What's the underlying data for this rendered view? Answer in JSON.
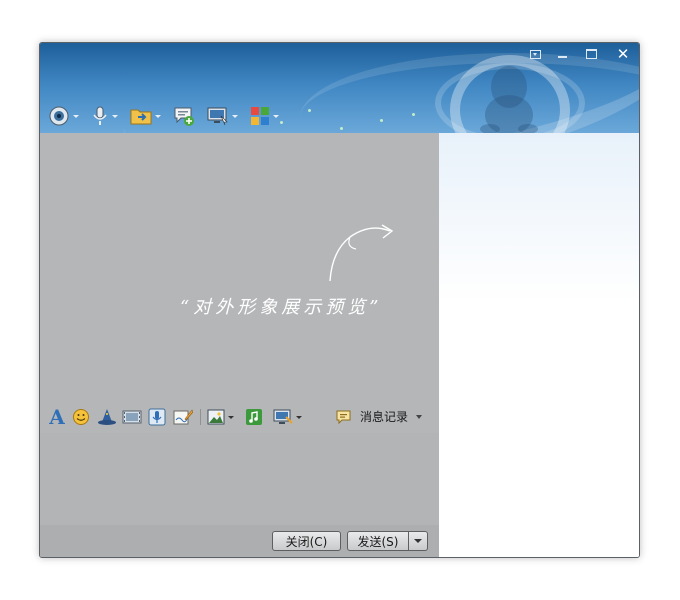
{
  "preview": {
    "text": "“对外形象展示预览”"
  },
  "toolbar": {
    "items": [
      {
        "icon": "video-camera-icon",
        "has_dropdown": true
      },
      {
        "icon": "microphone-icon",
        "has_dropdown": true
      },
      {
        "icon": "file-transfer-icon",
        "has_dropdown": true
      },
      {
        "icon": "group-chat-add-icon",
        "has_dropdown": false
      },
      {
        "icon": "remote-desktop-icon",
        "has_dropdown": true
      },
      {
        "icon": "apps-grid-icon",
        "has_dropdown": true
      }
    ]
  },
  "format_toolbar": {
    "font_label": "A",
    "items": [
      "font-icon",
      "emoji-icon",
      "magic-hat-icon",
      "film-icon",
      "voice-message-icon",
      "handwriting-icon",
      "image-icon",
      "music-icon",
      "screenshot-icon"
    ]
  },
  "message_history": {
    "label": "消息记录"
  },
  "buttons": {
    "close_label": "关闭(C)",
    "send_label": "发送(S)"
  },
  "colors": {
    "header_top": "#1e5f99",
    "header_bottom": "#6ba8d9",
    "pane_gray": "#b5b6b8",
    "accent_blue": "#2f6fb8"
  }
}
